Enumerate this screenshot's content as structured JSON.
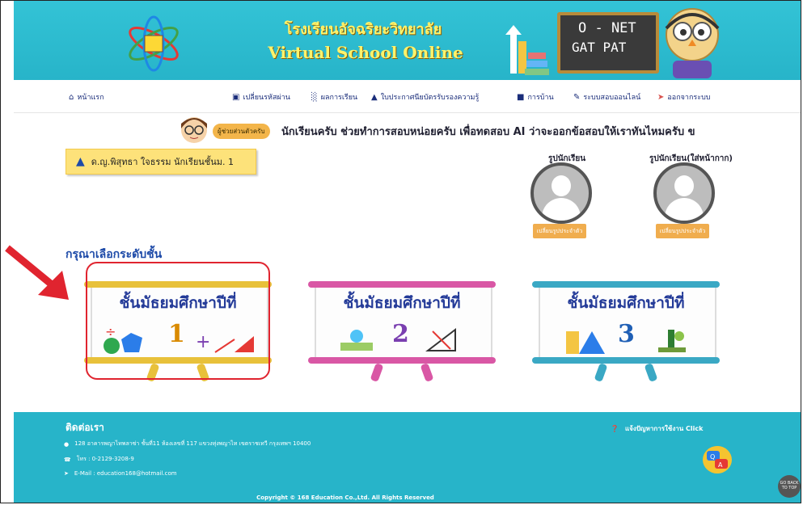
{
  "header": {
    "school_name_th": "โรงเรียนอัจฉริยะวิทยาลัย",
    "school_name_en": "Virtual School Online",
    "board_line1": "O - NET",
    "board_line2": "GAT PAT",
    "logo_icon": "atom-logo-icon",
    "mascot_icon": "owl-mascot-icon"
  },
  "nav": {
    "items": [
      {
        "label": "หน้าแรก",
        "icon": "home-icon"
      },
      {
        "label": "เปลี่ยนรหัสผ่าน",
        "icon": "lock-icon"
      },
      {
        "label": "ผลการเรียน",
        "icon": "bar-chart-icon"
      },
      {
        "label": "ใบประกาศนียบัตรรับรองความรู้",
        "icon": "graduation-cap-icon"
      },
      {
        "label": "การบ้าน",
        "icon": "book-icon"
      },
      {
        "label": "ระบบสอบออนไลน์",
        "icon": "edit-icon"
      },
      {
        "label": "ออกจากระบบ",
        "icon": "sign-out-icon"
      }
    ]
  },
  "announcement": {
    "speaker_label": "ผู้ช่วยส่วนตัวครับ",
    "text": "นักเรียนครับ ช่วยทำการสอบหน่อยครับ เพื่อทดสอบ AI ว่าจะออกข้อสอบให้เราทันไหมครับ ข"
  },
  "student": {
    "name": "ด.ญ.พิสุทธา ใจธรรม นักเรียนชั้นม. 1",
    "photo_label": "รูปนักเรียน",
    "mask_photo_label": "รูปนักเรียน(ใส่หน้ากาก)",
    "change_photo_button": "เปลี่ยนรูปประจำตัว",
    "change_mask_photo_button": "เปลี่ยนรูปประจำตัว"
  },
  "grades": {
    "title": "กรุณาเลือกระดับชั้น",
    "items": [
      {
        "label": "ชั้นมัธยมศึกษาปีที่",
        "number": "1",
        "color": "#e8c13a",
        "num_color": "#d98a00"
      },
      {
        "label": "ชั้นมัธยมศึกษาปีที่",
        "number": "2",
        "color": "#d957a5",
        "num_color": "#7a3fb0"
      },
      {
        "label": "ชั้นมัธยมศึกษาปีที่",
        "number": "3",
        "color": "#3aa8c4",
        "num_color": "#1f5fb5"
      }
    ]
  },
  "footer": {
    "contact_title": "ติดต่อเรา",
    "address": "128 อาคารพญาไทพลาซ่า ชั้นที่11 ห้องเลขที่ 117 แขวงทุ่งพญาไท เขตราชเทวี กรุงเทพฯ 10400",
    "phone": "โทร : 0-2129-3208-9",
    "email": "E-Mail : education168@hotmail.com",
    "help": "แจ้งปัญหาการใช้งาน Click",
    "copyright": "Copyright © 168 Education Co.,Ltd. All Rights Reserved",
    "go_top": "GO BACK TO TOP"
  },
  "colors": {
    "banner": "#2fbcd0",
    "nav_text": "#1a2d7a",
    "highlight": "#e0242f",
    "accent_button": "#f0ad4e"
  }
}
